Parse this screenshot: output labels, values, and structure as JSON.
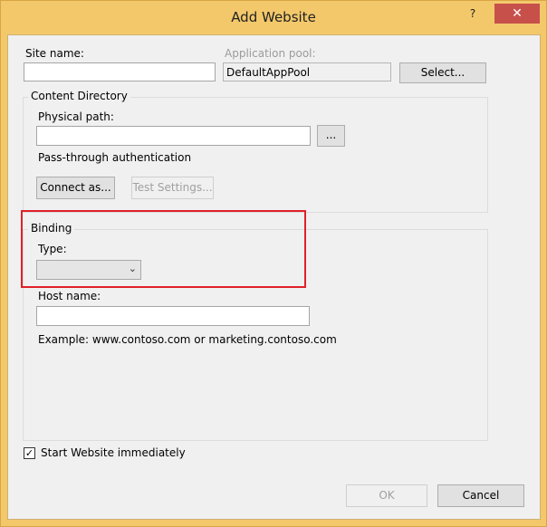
{
  "window": {
    "title": "Add Website",
    "help_label": "?",
    "close_label": "✕"
  },
  "site_name": {
    "label": "Site name:",
    "value": ""
  },
  "application_pool": {
    "label": "Application pool:",
    "value": "DefaultAppPool",
    "select_label": "Select..."
  },
  "content_directory": {
    "title": "Content Directory",
    "physical_path_label": "Physical path:",
    "physical_path_value": "",
    "browse_label": "...",
    "pass_through_label": "Pass-through authentication",
    "connect_as_label": "Connect as...",
    "test_settings_label": "Test Settings..."
  },
  "binding": {
    "title": "Binding",
    "type_label": "Type:",
    "type_value": "",
    "chevron_glyph": "⌄",
    "host_name_label": "Host name:",
    "host_name_value": "",
    "example_text": "Example: www.contoso.com or marketing.contoso.com"
  },
  "start_website": {
    "label": "Start Website immediately",
    "checked": true,
    "check_glyph": "✓"
  },
  "footer": {
    "ok_label": "OK",
    "cancel_label": "Cancel"
  },
  "colors": {
    "title_bar": "#f3c86b",
    "close_button": "#c7504b",
    "highlight": "#e0202a"
  }
}
